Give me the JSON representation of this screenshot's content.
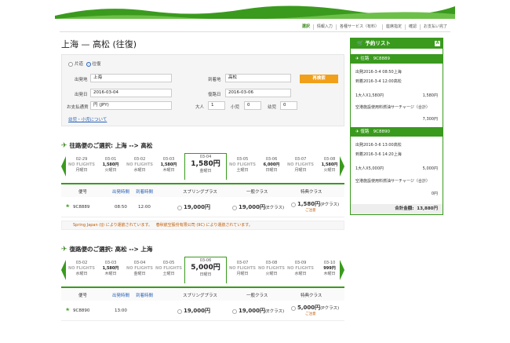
{
  "steps": [
    "選択",
    "情報入力",
    "各種サービス（有料）",
    "座席指定",
    "確認",
    "お支払い完了"
  ],
  "title": "上海 — 高松 (往復)",
  "search": {
    "oneway": "片道",
    "roundtrip": "往復",
    "from_label": "出発地",
    "from_val": "上海",
    "to_label": "到着地",
    "to_val": "高松",
    "dep_label": "出発日",
    "dep_val": "2016-03-04",
    "ret_label": "復路日",
    "ret_val": "2016-03-06",
    "cur_label": "お支払通貨",
    "cur_val": "円 (JPY)",
    "adult_label": "大人",
    "adult_val": "1",
    "child_label": "小児",
    "child_val": "0",
    "infant_label": "幼児",
    "infant_val": "0",
    "button": "再検索",
    "link": "幼児・小児について"
  },
  "outbound": {
    "title": "往路便のご選択: 上海 --> 高松",
    "dates": [
      {
        "d": "02-29",
        "p": "NO FLIGHTS",
        "w": "月曜日"
      },
      {
        "d": "03-01",
        "p": "1,580円",
        "w": "火曜日"
      },
      {
        "d": "03-02",
        "p": "NO FLIGHTS",
        "w": "水曜日"
      },
      {
        "d": "03-03",
        "p": "1,580円",
        "w": "木曜日"
      },
      {
        "d": "03-04",
        "p": "1,580円",
        "w": "金曜日"
      },
      {
        "d": "03-05",
        "p": "NO FLIGHTS",
        "w": "土曜日"
      },
      {
        "d": "03-06",
        "p": "6,000円",
        "w": "日曜日"
      },
      {
        "d": "03-07",
        "p": "NO FLIGHTS",
        "w": "月曜日"
      },
      {
        "d": "03-08",
        "p": "1,580円",
        "w": "火曜日"
      }
    ],
    "flight": "9C8889",
    "dep": "08:50",
    "arr": "12:00",
    "spring": "19,000円",
    "std": "19,000円",
    "std_sub": "(Eクラス)",
    "special": "1,580円",
    "special_sub": "(Pクラス)",
    "special_note": "ご注意",
    "note": "Spring Japan (IJ) により運航されています。",
    "note2": "春秋航空股份有限公司 (9C) により運航されています。"
  },
  "inbound": {
    "title": "復路便のご選択: 高松 --> 上海",
    "dates": [
      {
        "d": "03-02",
        "p": "NO FLIGHTS",
        "w": "水曜日"
      },
      {
        "d": "03-03",
        "p": "1,580円",
        "w": "木曜日"
      },
      {
        "d": "03-04",
        "p": "NO FLIGHTS",
        "w": "金曜日"
      },
      {
        "d": "03-05",
        "p": "NO FLIGHTS",
        "w": "土曜日"
      },
      {
        "d": "03-06",
        "p": "5,000円",
        "w": "日曜日"
      },
      {
        "d": "03-07",
        "p": "NO FLIGHTS",
        "w": "月曜日"
      },
      {
        "d": "03-08",
        "p": "NO FLIGHTS",
        "w": "火曜日"
      },
      {
        "d": "03-09",
        "p": "NO FLIGHTS",
        "w": "水曜日"
      },
      {
        "d": "03-10",
        "p": "999円",
        "w": "木曜日"
      }
    ],
    "flight": "9C8890",
    "dep": "13:00",
    "spring": "19,000円",
    "std": "19,000円",
    "std_sub": "(Eクラス)",
    "special": "5,000円",
    "special_sub": "(Pクラス)",
    "special_note": "ご注意"
  },
  "table_headers": {
    "flight": "便号",
    "dep": "出発時間",
    "arr": "到着時間",
    "spring": "スプリングプラス",
    "std": "一般クラス",
    "special": "特典クラス"
  },
  "cart": {
    "title": "予約リスト",
    "out_label": "往路",
    "out_flight": "9C8889",
    "out_dep": "出発2016-3-4 08:50上海",
    "out_arr": "到着2016-3-4 12:00高松",
    "out_pax": "1大人X1,580円",
    "out_pax_val": "1,580円",
    "out_fee": "空港施設使用料燃油サーチャージ（合計）",
    "out_fee_val": "7,300円",
    "in_label": "復路",
    "in_flight": "9C8890",
    "in_dep": "出発2016-3-6 13:00高松",
    "in_arr": "到着2016-3-6 14:20上海",
    "in_pax": "1大人X5,000円",
    "in_pax_val": "5,000円",
    "in_fee": "空港施設使用料燃油サーチャージ（合計）",
    "in_fee_val": "0円",
    "total_label": "合計金額:",
    "total_val": "13,880円"
  },
  "colors": {
    "green": "#3a9a1e",
    "orange": "#f0a01a",
    "blue": "#2a62b8"
  }
}
